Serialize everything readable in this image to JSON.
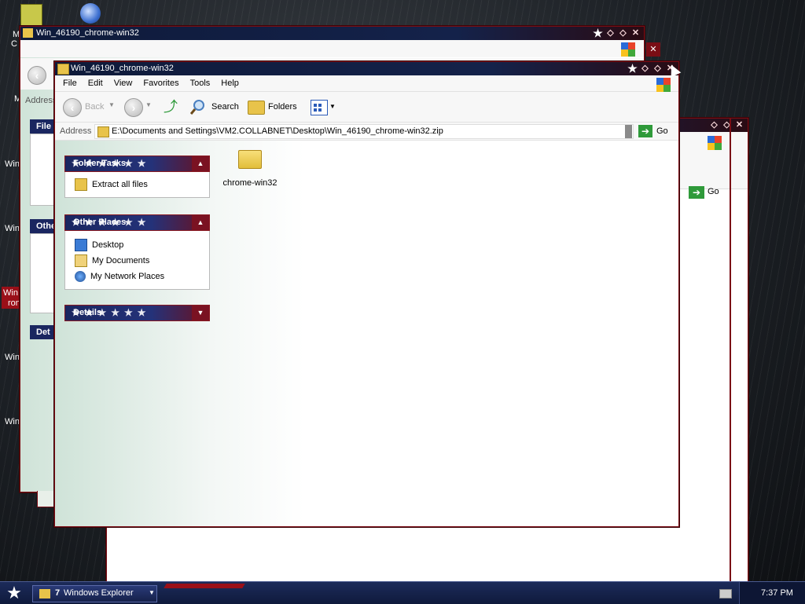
{
  "desktop": {
    "icon_labels": [
      "M",
      "C",
      "M",
      "Win",
      "Win",
      "Win",
      "ron",
      "Win",
      "Win"
    ]
  },
  "back_window_1": {
    "title": "Win_46190_chrome-win32",
    "address_label": "Address",
    "panel_labels": [
      "File",
      "Othe",
      "Det"
    ]
  },
  "back_window_2": {
    "go_label": "Go"
  },
  "main_window": {
    "title": "Win_46190_chrome-win32",
    "menu": [
      "File",
      "Edit",
      "View",
      "Favorites",
      "Tools",
      "Help"
    ],
    "toolbar": {
      "back_label": "Back",
      "search_label": "Search",
      "folders_label": "Folders"
    },
    "address": {
      "label": "Address",
      "value": "E:\\Documents and Settings\\VM2.COLLABNET\\Desktop\\Win_46190_chrome-win32.zip",
      "go_label": "Go"
    },
    "folder_tasks": {
      "title": "Folder Tasks",
      "items": [
        "Extract all files"
      ]
    },
    "other_places": {
      "title": "Other Places",
      "items": [
        "Desktop",
        "My Documents",
        "My Network Places"
      ]
    },
    "details": {
      "title": "Details"
    },
    "files": [
      {
        "name": "chrome-win32",
        "icon": "folder-icon"
      }
    ]
  },
  "taskbar": {
    "group_count": "7",
    "group_label": "Windows Explorer",
    "clock": "7:37 PM"
  },
  "colors": {
    "title_blue": "#14224a",
    "accent_red": "#7a0d15",
    "panel_blue": "#1a2660"
  }
}
